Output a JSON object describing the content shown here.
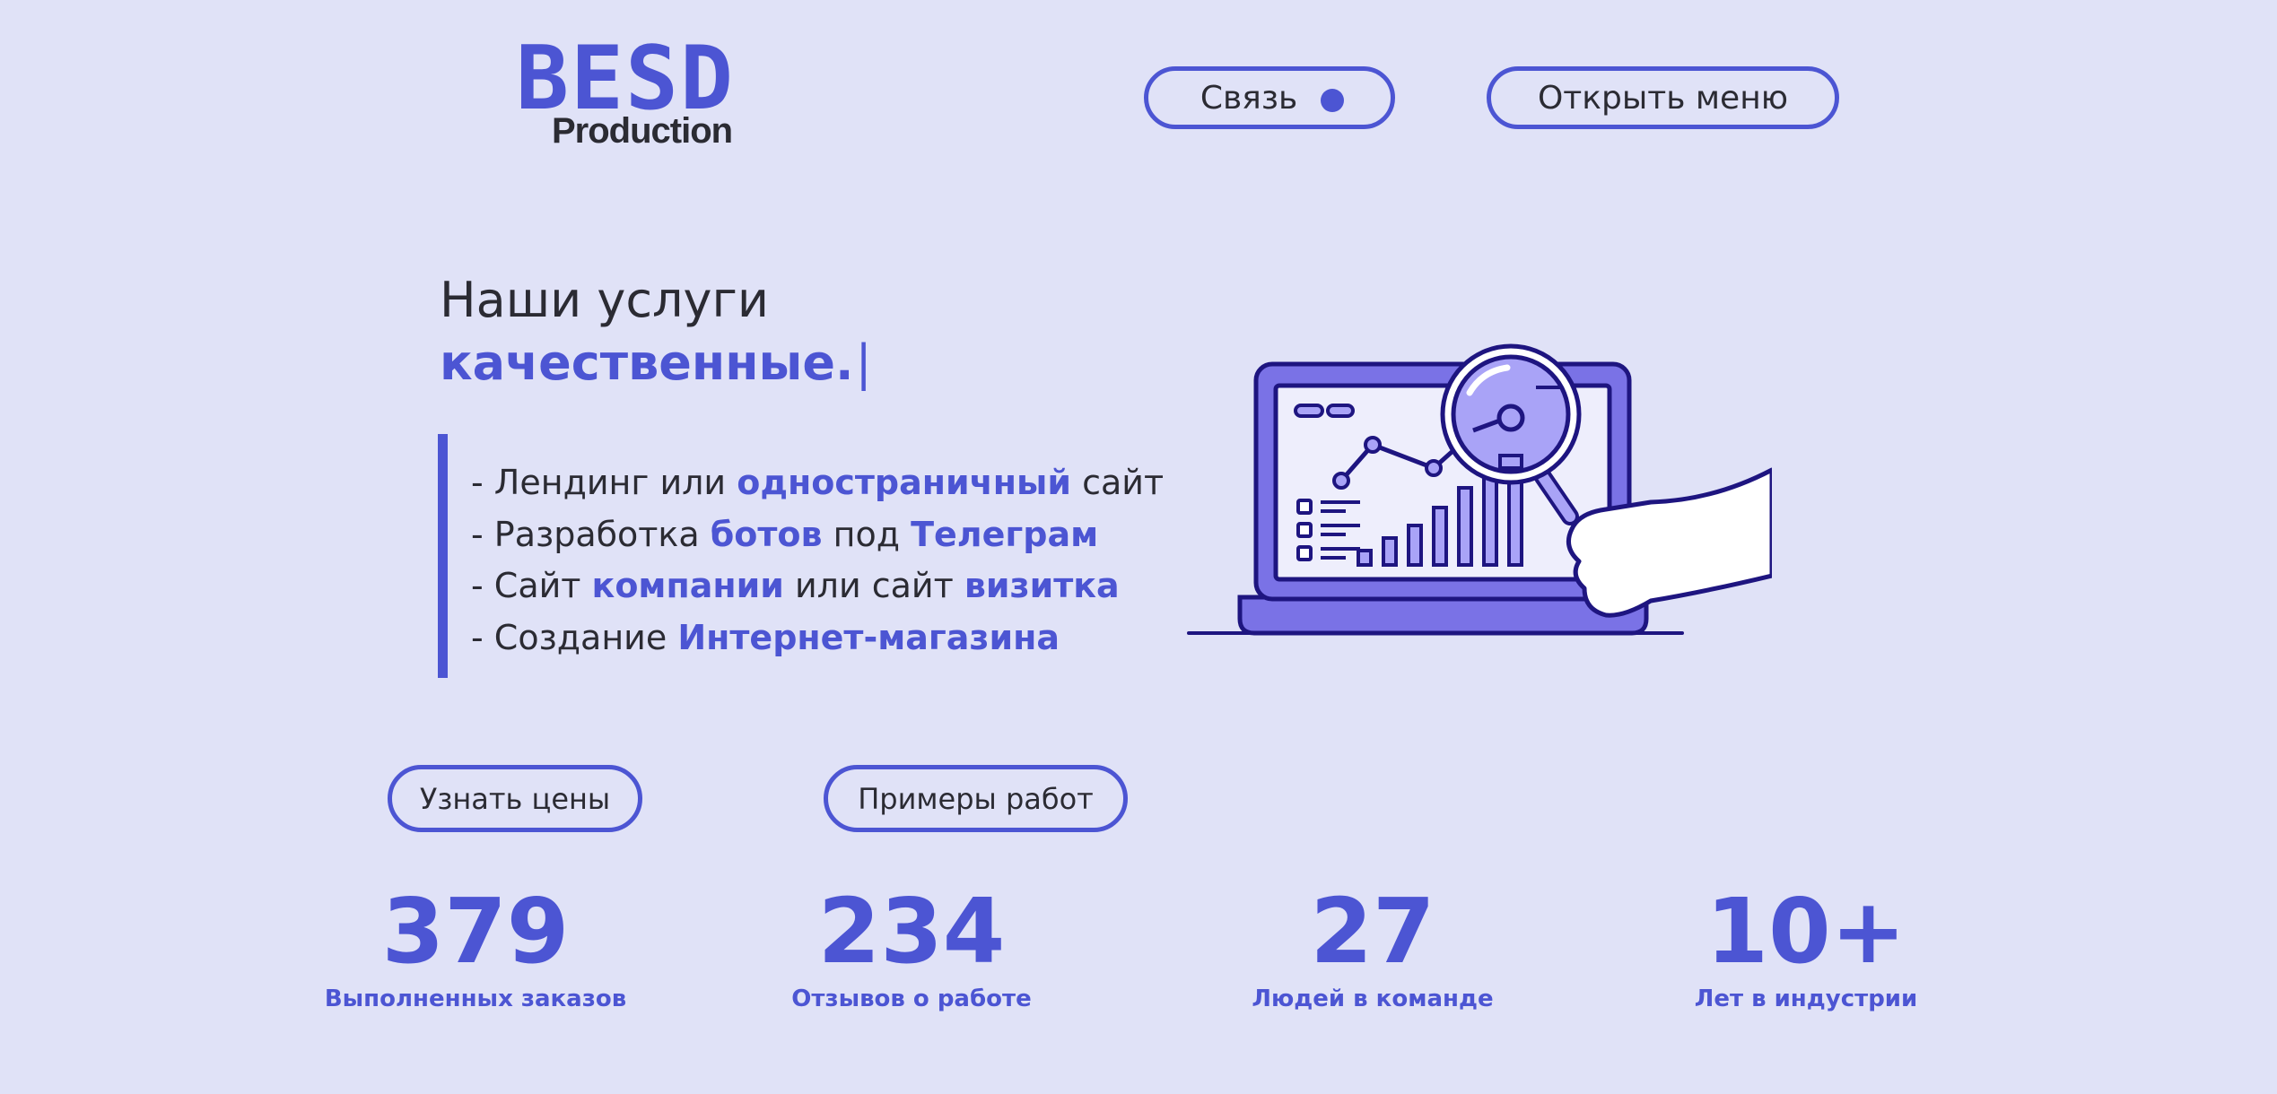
{
  "logo": {
    "brand_text": "BESD",
    "sub_text": "Production"
  },
  "header": {
    "contact_label": "Связь",
    "menu_label": "Открыть меню"
  },
  "hero": {
    "title_line1": "Наши услуги",
    "title_line2": "качественные.",
    "caret": "|"
  },
  "services": [
    [
      "- Лендинг или ",
      "одностраничный",
      " сайт"
    ],
    [
      "- Разработка ",
      "ботов",
      " под ",
      "Телеграм"
    ],
    [
      "- Сайт ",
      "компании",
      " или сайт ",
      "визитка"
    ],
    [
      "- Создание ",
      "Интернет-магазина"
    ]
  ],
  "illustration": {
    "name": "laptop-analytics-magnifier-illustration"
  },
  "buttons": {
    "prices_label": "Узнать цены",
    "works_label": "Примеры работ"
  },
  "stats": [
    {
      "value": "379",
      "caption": "Выполненных заказов"
    },
    {
      "value": "234",
      "caption": "Отзывов о работе"
    },
    {
      "value": "27",
      "caption": "Людей в команде"
    },
    {
      "value": "10+",
      "caption": "Лет в индустрии"
    }
  ],
  "colors": {
    "background": "#e0e2f7",
    "accent": "#4c55d3",
    "text": "#2b2b33",
    "illustration_dark": "#1e1580",
    "illustration_mid": "#7a72e6",
    "illustration_light": "#a9a3f7"
  }
}
